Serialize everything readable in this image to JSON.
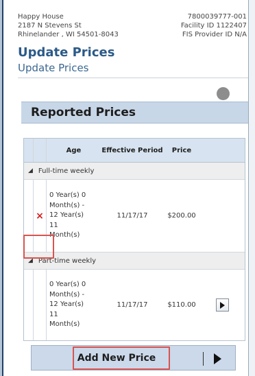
{
  "header": {
    "provider_name": "Happy House",
    "address_line1": "2187 N Stevens St",
    "address_line2": "Rhinelander , WI 54501-8043",
    "provider_number": "7800039777-001",
    "facility_id": "Facility ID 1122407",
    "fis_provider_id": "FIS Provider ID N/A"
  },
  "page": {
    "title": "Update Prices",
    "subtitle": "Update Prices"
  },
  "section": {
    "title": "Reported Prices"
  },
  "table": {
    "columns": [
      "Age",
      "Effective Period",
      "Price"
    ],
    "groups": [
      {
        "label": "Full-time weekly",
        "rows": [
          {
            "age_lines": [
              "0 Year(s) 0",
              "Month(s) -",
              "12 Year(s)",
              "11",
              "Month(s)"
            ],
            "effective_period": "11/17/17",
            "price": "$200.00",
            "action": "delete-icon"
          }
        ]
      },
      {
        "label": "Part-time weekly",
        "rows": [
          {
            "age_lines": [
              "0 Year(s) 0",
              "Month(s) -",
              "12 Year(s)",
              "11",
              "Month(s)"
            ],
            "effective_period": "11/17/17",
            "price": "$110.00",
            "action": "play-icon"
          }
        ]
      }
    ]
  },
  "footer": {
    "add_button_label": "Add New Price",
    "add_button_icon": "play-icon"
  },
  "colors": {
    "accent": "#2c5a88",
    "highlight": "#d9534f",
    "delete": "#d21e1e"
  }
}
